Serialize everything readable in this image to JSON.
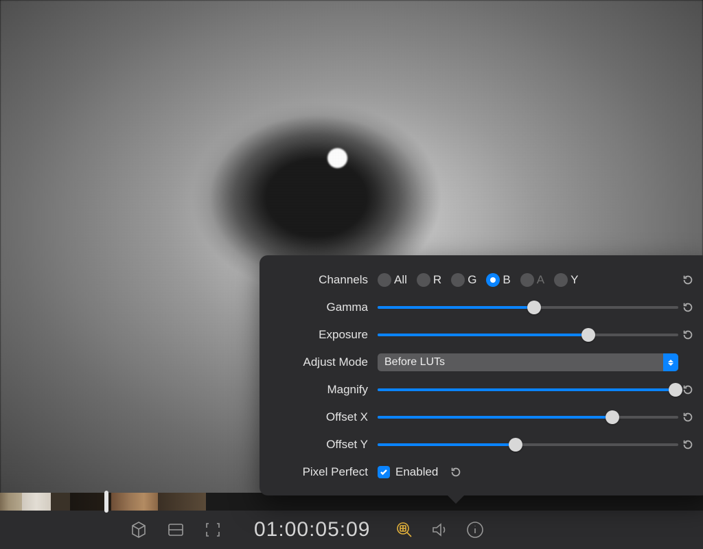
{
  "timecode": "01:00:05:09",
  "popover": {
    "channels": {
      "label": "Channels",
      "options": [
        {
          "label": "All",
          "selected": false,
          "dim": false
        },
        {
          "label": "R",
          "selected": false,
          "dim": false
        },
        {
          "label": "G",
          "selected": false,
          "dim": false
        },
        {
          "label": "B",
          "selected": true,
          "dim": false
        },
        {
          "label": "A",
          "selected": false,
          "dim": true
        },
        {
          "label": "Y",
          "selected": false,
          "dim": false
        }
      ]
    },
    "gamma": {
      "label": "Gamma",
      "pct": 52
    },
    "exposure": {
      "label": "Exposure",
      "pct": 70
    },
    "adjust_mode": {
      "label": "Adjust Mode",
      "value": "Before LUTs"
    },
    "magnify": {
      "label": "Magnify",
      "pct": 99
    },
    "offset_x": {
      "label": "Offset X",
      "pct": 78
    },
    "offset_y": {
      "label": "Offset Y",
      "pct": 46
    },
    "pixel_perfect": {
      "label": "Pixel Perfect",
      "checkbox_label": "Enabled",
      "checked": true
    }
  },
  "toolbar_icons": {
    "cube": "cube-icon",
    "rows": "rows-icon",
    "crop": "crop-brackets-icon",
    "magnify": "magnify-grid-icon",
    "speaker": "speaker-icon",
    "info": "info-icon"
  }
}
